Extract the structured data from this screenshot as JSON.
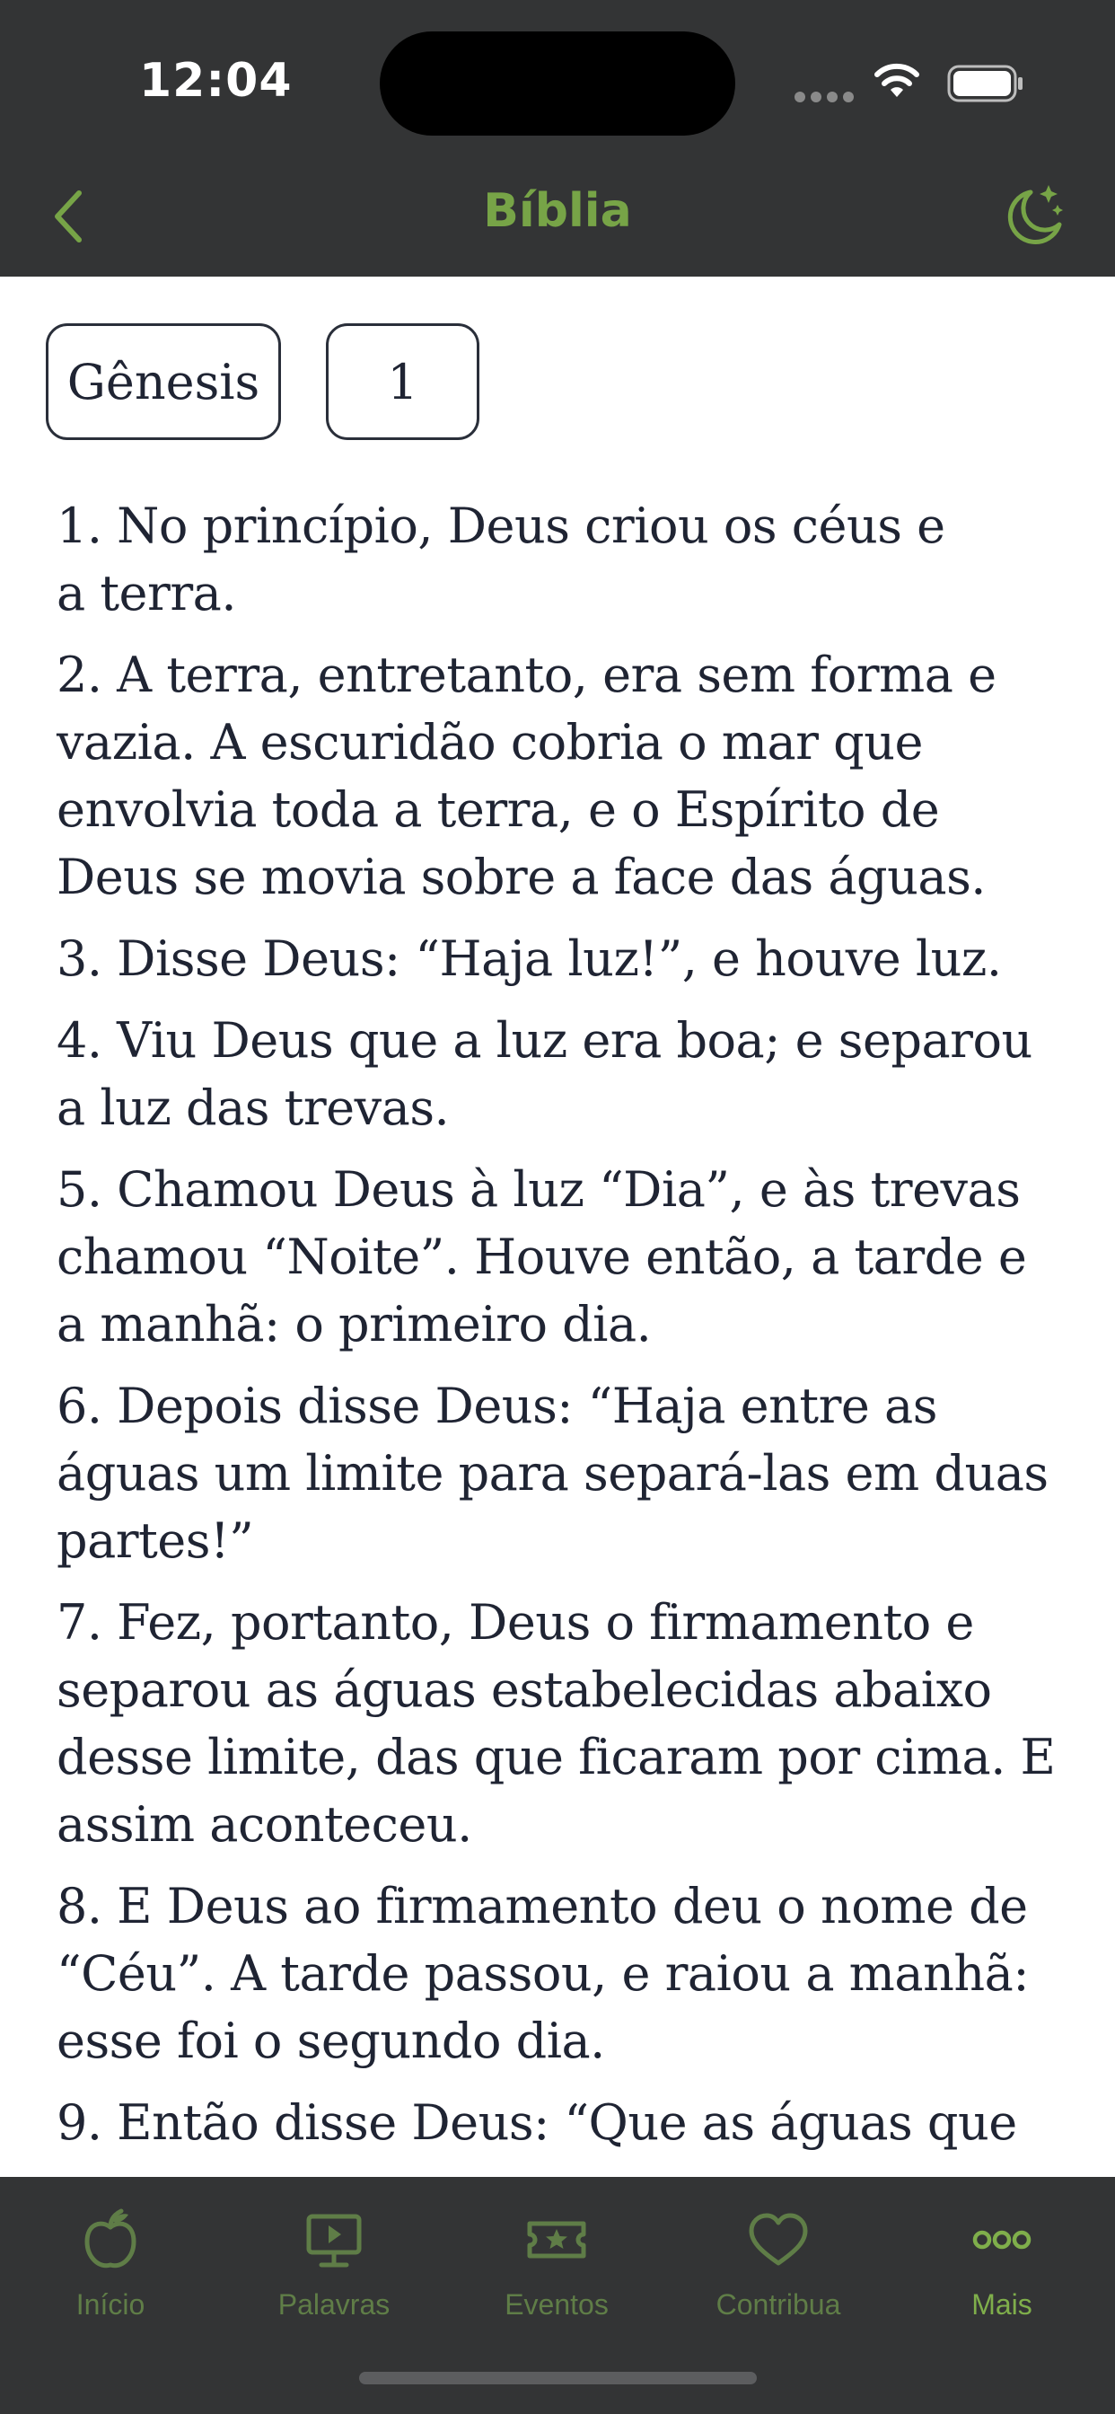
{
  "status_bar": {
    "time": "12:04",
    "icons": [
      "cellular-signal-icon",
      "wifi-icon",
      "battery-icon"
    ]
  },
  "nav": {
    "title": "Bíblia",
    "back_icon": "chevron-left-icon",
    "theme_icon": "moon-stars-icon"
  },
  "selectors": {
    "book": "Gênesis",
    "chapter": "1"
  },
  "verses": [
    "1. No princípio, Deus criou os céus e a terra.",
    "2. A terra, entretanto, era sem forma e vazia. A escuridão cobria o mar que envolvia toda a terra, e o Espírito de Deus se movia sobre a face das águas.",
    "3. Disse Deus: “Haja luz!”, e houve luz.",
    "4. Viu Deus que a luz era boa; e separou a luz das trevas.",
    "5. Chamou Deus à luz “Dia”, e às trevas chamou “Noite”. Houve então, a tarde e a manhã: o primeiro dia.",
    "6. Depois disse Deus: “Haja entre as águas um limite para separá-las em duas partes!”",
    "7. Fez, portanto, Deus o firmamento e separou as águas estabelecidas abaixo desse limite, das que ficaram por cima. E assim aconteceu.",
    "8. E Deus ao firmamento deu o nome de “Céu”. A tarde passou, e raiou a manhã: esse foi o segundo dia.",
    "9. Então disse Deus: “Que as águas que"
  ],
  "next_icon": "arrow-right-icon",
  "tabs": [
    {
      "label": "Início",
      "icon": "apple-icon",
      "active": false
    },
    {
      "label": "Palavras",
      "icon": "monitor-icon",
      "active": false
    },
    {
      "label": "Eventos",
      "icon": "ticket-star-icon",
      "active": false
    },
    {
      "label": "Contribua",
      "icon": "heart-icon",
      "active": false
    },
    {
      "label": "Mais",
      "icon": "more-dots-icon",
      "active": true
    }
  ],
  "colors": {
    "accent": "#77a447",
    "bar_background": "#333435",
    "text": "#1f2433",
    "tab_inactive": "#5f7d47"
  }
}
